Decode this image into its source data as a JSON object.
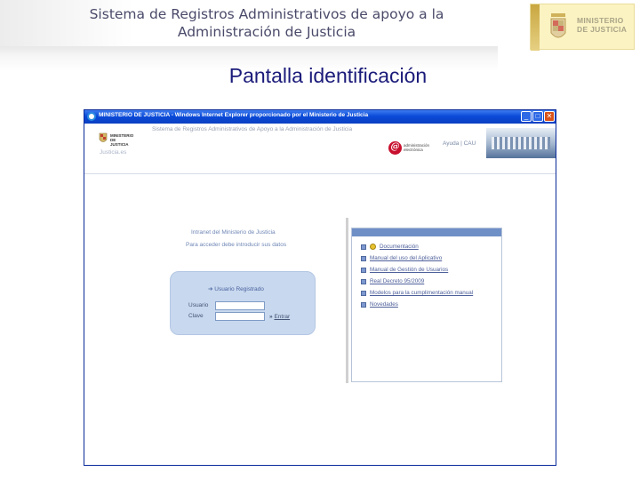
{
  "slide": {
    "title_line1": "Sistema de Registros Administrativos de apoyo a la",
    "title_line2": "Administración de Justicia",
    "logo_text_line1": "MINISTERIO",
    "logo_text_line2": "DE JUSTICIA",
    "screen_title": "Pantalla identificación"
  },
  "window": {
    "title": "MINISTERIO DE JUSTICIA - Windows Internet Explorer proporcionado por el Ministerio de Justicia",
    "controls": {
      "minimize": "_",
      "maximize": "□",
      "close": "✕"
    }
  },
  "page_header": {
    "org_logo_line1": "MINISTERIO",
    "org_logo_line2": "DE JUSTICIA",
    "domain": "Justicia.es",
    "app_title": "Sistema de Registros Administrativos de Apoyo a la Administración de Justicia",
    "ae_logo_letter": "@",
    "ae_logo_line1": "administración",
    "ae_logo_line2": "electrónica",
    "links": "Ayuda | CAU"
  },
  "intranet": {
    "heading": "Intranet del Ministerio de Justicia",
    "subheading": "Para acceder debe introducir sus datos"
  },
  "login": {
    "title": "➔ Usuario Registrado",
    "user_label": "Usuario",
    "password_label": "Clave",
    "user_value": "",
    "password_value": "",
    "enter_prefix": "»",
    "enter_label": "Entrar"
  },
  "links": [
    {
      "label": "Documentación",
      "icon": "document-icon"
    },
    {
      "label": "Manual del uso del Aplicativo",
      "icon": "bullet-icon"
    },
    {
      "label": "Manual de Gestión de Usuarios",
      "icon": "bullet-icon"
    },
    {
      "label": "Real Decreto 95/2009",
      "icon": "bullet-icon"
    },
    {
      "label": "Modelos para la cumplimentación manual",
      "icon": "bullet-icon"
    },
    {
      "label": "Novedades",
      "icon": "bullet-icon"
    }
  ],
  "colors": {
    "titlebar": "#0a4ad8",
    "screen_title": "#1b1b7a",
    "link": "#4d5f9a",
    "login_box": "#c8d8ee"
  }
}
